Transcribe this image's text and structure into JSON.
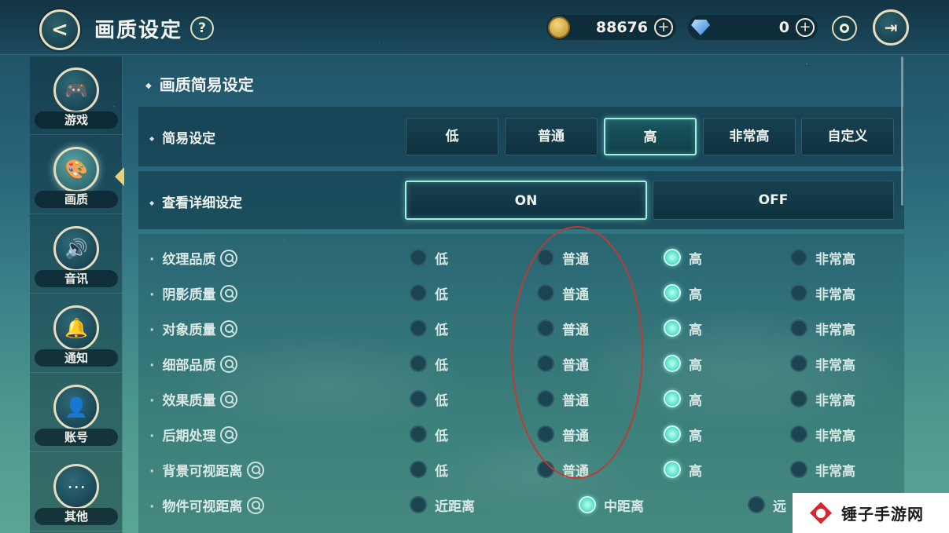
{
  "header": {
    "title": "画质设定",
    "help_label": "?",
    "gold_amount": "88676",
    "gem_amount": "0",
    "plus_label": "+"
  },
  "sidebar": {
    "items": [
      {
        "label": "游戏",
        "icon": "gamepad-icon"
      },
      {
        "label": "画质",
        "icon": "palette-icon"
      },
      {
        "label": "音讯",
        "icon": "speaker-icon"
      },
      {
        "label": "通知",
        "icon": "bell-icon"
      },
      {
        "label": "账号",
        "icon": "user-icon"
      },
      {
        "label": "其他",
        "icon": "more-icon"
      }
    ],
    "active_index": 1
  },
  "main": {
    "section_title": "画质简易设定",
    "simple_label": "简易设定",
    "simple_options": [
      "低",
      "普通",
      "高",
      "非常高",
      "自定义"
    ],
    "simple_selected": "高",
    "detail_toggle_label": "查看详细设定",
    "detail_on": "ON",
    "detail_off": "OFF",
    "detail_selected": "ON",
    "details": [
      {
        "label": "纹理品质",
        "options": [
          "低",
          "普通",
          "高",
          "非常高"
        ],
        "selected": "高"
      },
      {
        "label": "阴影质量",
        "options": [
          "低",
          "普通",
          "高",
          "非常高"
        ],
        "selected": "高"
      },
      {
        "label": "对象质量",
        "options": [
          "低",
          "普通",
          "高",
          "非常高"
        ],
        "selected": "高"
      },
      {
        "label": "细部品质",
        "options": [
          "低",
          "普通",
          "高",
          "非常高"
        ],
        "selected": "高"
      },
      {
        "label": "效果质量",
        "options": [
          "低",
          "普通",
          "高",
          "非常高"
        ],
        "selected": "高"
      },
      {
        "label": "后期处理",
        "options": [
          "低",
          "普通",
          "高",
          "非常高"
        ],
        "selected": "高"
      },
      {
        "label": "背景可视距离",
        "options": [
          "低",
          "普通",
          "高",
          "非常高"
        ],
        "selected": "高"
      },
      {
        "label": "物件可视距离",
        "options": [
          "近距离",
          "中距离",
          "远"
        ],
        "selected": "中距离"
      }
    ]
  },
  "watermark": {
    "text": "锤子手游网"
  },
  "colors": {
    "accent": "#9ef0e2",
    "annotation": "#c03a32",
    "badge": "#d8262c"
  }
}
